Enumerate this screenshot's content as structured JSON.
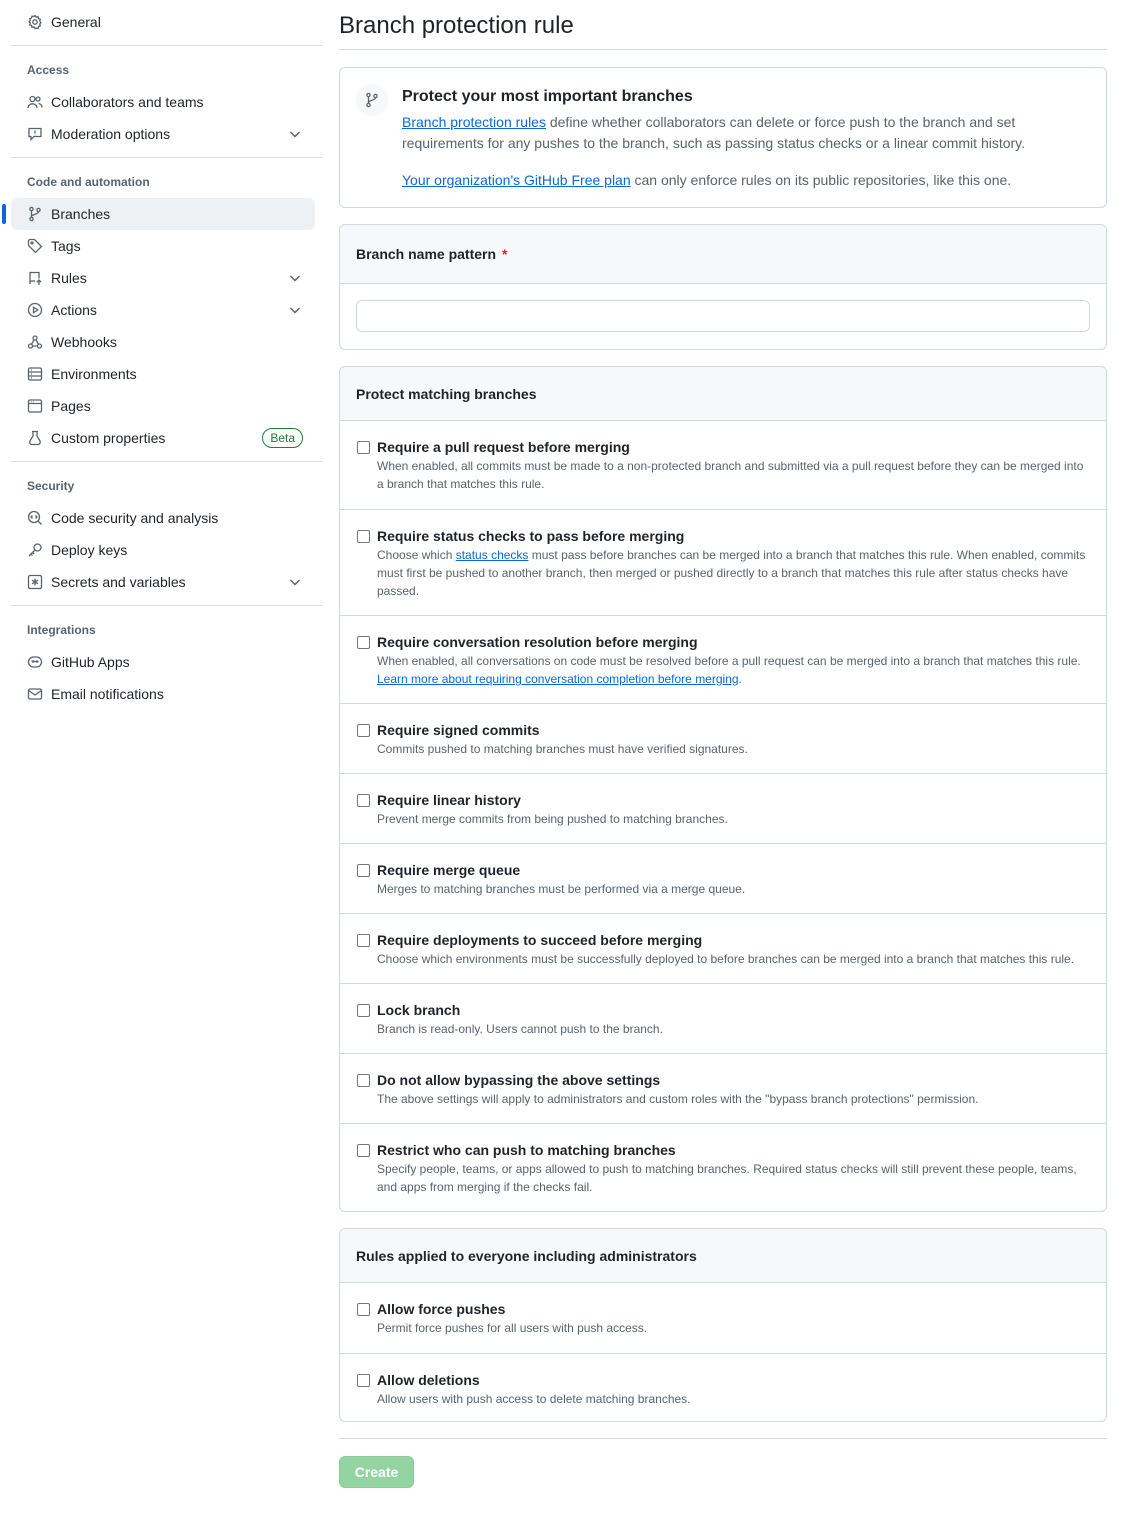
{
  "sidebar": {
    "general": {
      "label": "General",
      "icon": "gear-icon"
    },
    "access": {
      "heading": "Access",
      "items": [
        {
          "label": "Collaborators and teams",
          "icon": "people-icon"
        },
        {
          "label": "Moderation options",
          "icon": "report-icon",
          "expandable": true
        }
      ]
    },
    "code": {
      "heading": "Code and automation",
      "items": [
        {
          "label": "Branches",
          "icon": "git-branch-icon",
          "active": true
        },
        {
          "label": "Tags",
          "icon": "tag-icon"
        },
        {
          "label": "Rules",
          "icon": "repo-push-icon",
          "expandable": true
        },
        {
          "label": "Actions",
          "icon": "play-icon",
          "expandable": true
        },
        {
          "label": "Webhooks",
          "icon": "webhook-icon"
        },
        {
          "label": "Environments",
          "icon": "server-icon"
        },
        {
          "label": "Pages",
          "icon": "browser-icon"
        },
        {
          "label": "Custom properties",
          "icon": "note-icon",
          "badge": "Beta"
        }
      ]
    },
    "security": {
      "heading": "Security",
      "items": [
        {
          "label": "Code security and analysis",
          "icon": "codescan-icon"
        },
        {
          "label": "Deploy keys",
          "icon": "key-icon"
        },
        {
          "label": "Secrets and variables",
          "icon": "asterisk-icon",
          "expandable": true
        }
      ]
    },
    "integrations": {
      "heading": "Integrations",
      "items": [
        {
          "label": "GitHub Apps",
          "icon": "hubot-icon"
        },
        {
          "label": "Email notifications",
          "icon": "mail-icon"
        }
      ]
    }
  },
  "main": {
    "title": "Branch protection rule",
    "intro": {
      "title": "Protect your most important branches",
      "link1": "Branch protection rules",
      "text1": " define whether collaborators can delete or force push to the branch and set requirements for any pushes to the branch, such as passing status checks or a linear commit history.",
      "link2": "Your organization's GitHub Free plan",
      "text2": " can only enforce rules on its public repositories, like this one."
    },
    "pattern": {
      "label": "Branch name pattern",
      "required_mark": "*",
      "value": ""
    },
    "protect": {
      "heading": "Protect matching branches",
      "rules": [
        {
          "title": "Require a pull request before merging",
          "desc": "When enabled, all commits must be made to a non-protected branch and submitted via a pull request before they can be merged into a branch that matches this rule."
        },
        {
          "title": "Require status checks to pass before merging",
          "desc_before": "Choose which ",
          "desc_link": "status checks",
          "desc_after": " must pass before branches can be merged into a branch that matches this rule. When enabled, commits must first be pushed to another branch, then merged or pushed directly to a branch that matches this rule after status checks have passed."
        },
        {
          "title": "Require conversation resolution before merging",
          "desc": "When enabled, all conversations on code must be resolved before a pull request can be merged into a branch that matches this rule.",
          "desc_link": "Learn more about requiring conversation completion before merging",
          "desc_after": "."
        },
        {
          "title": "Require signed commits",
          "desc": "Commits pushed to matching branches must have verified signatures."
        },
        {
          "title": "Require linear history",
          "desc": "Prevent merge commits from being pushed to matching branches."
        },
        {
          "title": "Require merge queue",
          "desc": "Merges to matching branches must be performed via a merge queue."
        },
        {
          "title": "Require deployments to succeed before merging",
          "desc": "Choose which environments must be successfully deployed to before branches can be merged into a branch that matches this rule."
        },
        {
          "title": "Lock branch",
          "desc": "Branch is read-only. Users cannot push to the branch."
        },
        {
          "title": "Do not allow bypassing the above settings",
          "desc": "The above settings will apply to administrators and custom roles with the \"bypass branch protections\" permission."
        },
        {
          "title": "Restrict who can push to matching branches",
          "desc": "Specify people, teams, or apps allowed to push to matching branches. Required status checks will still prevent these people, teams, and apps from merging if the checks fail."
        }
      ]
    },
    "everyone": {
      "heading": "Rules applied to everyone including administrators",
      "rules": [
        {
          "title": "Allow force pushes",
          "desc": "Permit force pushes for all users with push access."
        },
        {
          "title": "Allow deletions",
          "desc": "Allow users with push access to delete matching branches."
        }
      ]
    },
    "create_label": "Create"
  },
  "colors": {
    "accent": "#0969da",
    "create_button": "#94d3a2",
    "beta": "#1a7f37",
    "required": "#d1242f"
  }
}
